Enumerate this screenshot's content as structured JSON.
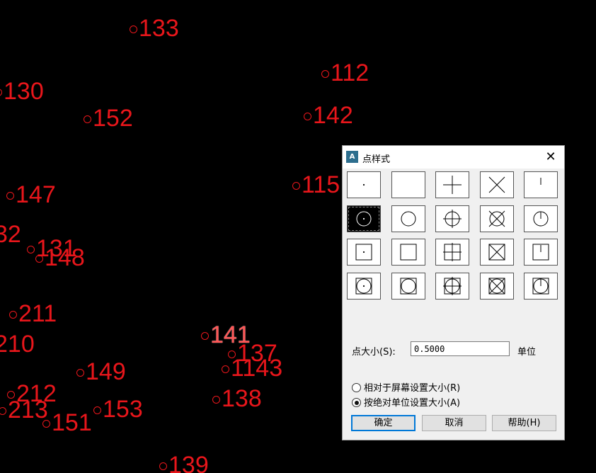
{
  "canvas": {
    "points": [
      "133",
      "112",
      "130",
      "152",
      "142",
      "147",
      "115",
      "32",
      "131",
      "148",
      "211",
      "210",
      "141",
      "137",
      "1143",
      "149",
      "212",
      "213",
      "151",
      "153",
      "138",
      "139"
    ]
  },
  "dialog": {
    "title": "点样式",
    "close_glyph": "✕",
    "size_label": "点大小(S):",
    "size_value": "0.5000",
    "unit_label": "单位",
    "radio_relative": "相对于屏幕设置大小(R)",
    "radio_absolute": "按绝对单位设置大小(A)",
    "selected_radio": "absolute",
    "selected_style_index": 5,
    "ok_label": "确定",
    "cancel_label": "取消",
    "help_label": "帮助(H)"
  },
  "colors": {
    "background": "#000000",
    "point_text": "#e8161b",
    "accent": "#0078d7"
  }
}
